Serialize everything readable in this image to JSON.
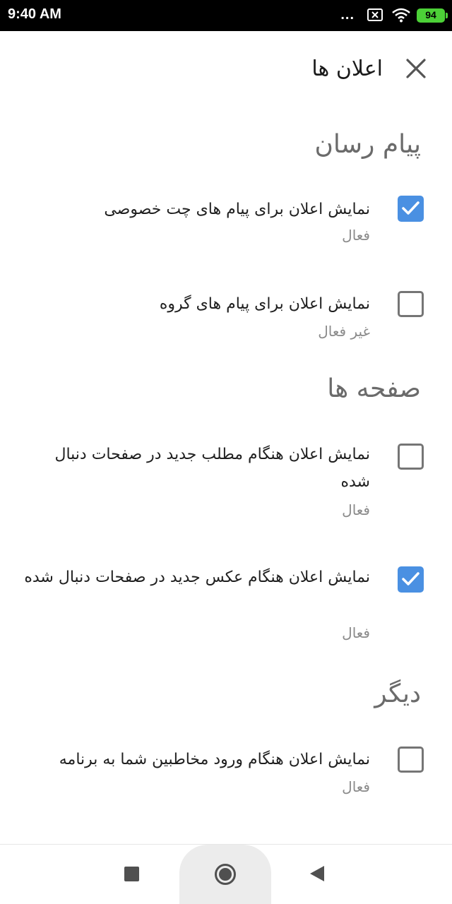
{
  "status_bar": {
    "time": "9:40 AM",
    "dots": "...",
    "battery": "94",
    "icons": [
      "close-box-icon",
      "wifi-icon",
      "battery-icon"
    ]
  },
  "header": {
    "title": "اعلان ها",
    "close_icon": "close-icon"
  },
  "sections": {
    "messenger": {
      "title": "پیام رسان",
      "items": [
        {
          "title": "نمایش اعلان برای پیام های چت خصوصی",
          "status": "فعال",
          "checked": true
        },
        {
          "title": "نمایش اعلان برای پیام های گروه",
          "status": "غیر فعال",
          "checked": false
        }
      ]
    },
    "pages": {
      "title": "صفحه ها",
      "items": [
        {
          "title": "نمایش اعلان هنگام مطلب جدید در صفحات دنبال شده",
          "status": "فعال",
          "checked": false
        },
        {
          "title": "نمایش اعلان هنگام عکس جدید در صفحات دنبال شده",
          "status": "فعال",
          "checked": true
        }
      ]
    },
    "other": {
      "title": "دیگر",
      "items": [
        {
          "title": "نمایش اعلان هنگام ورود مخاطبین شما به برنامه",
          "status": "فعال",
          "checked": false
        }
      ]
    }
  },
  "nav_bar": {
    "buttons": [
      "recent-apps-icon",
      "home-icon",
      "back-icon"
    ]
  },
  "colors": {
    "checkbox_checked": "#4a90e2",
    "checkbox_unchecked_border": "#757575",
    "battery": "#4cd137"
  }
}
